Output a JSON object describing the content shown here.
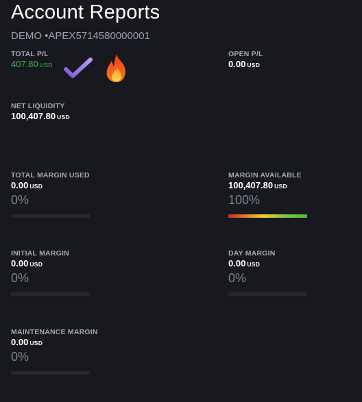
{
  "header": {
    "title": "Account Reports",
    "account_id": "DEMO •APEX5714580000001"
  },
  "metrics": {
    "total_pl": {
      "label": "TOTAL P/L",
      "value": "407.80",
      "unit": "USD"
    },
    "open_pl": {
      "label": "OPEN P/L",
      "value": "0.00",
      "unit": "USD"
    },
    "net_liquidity": {
      "label": "NET LIQUIDITY",
      "value": "100,407.80",
      "unit": "USD"
    },
    "total_margin_used": {
      "label": "TOTAL MARGIN USED",
      "value": "0.00",
      "unit": "USD",
      "percent": "0%",
      "fill_fraction": 0
    },
    "margin_available": {
      "label": "MARGIN AVAILABLE",
      "value": "100,407.80",
      "unit": "USD",
      "percent": "100%",
      "fill_fraction": 1
    },
    "initial_margin": {
      "label": "INITIAL MARGIN",
      "value": "0.00",
      "unit": "USD",
      "percent": "0%",
      "fill_fraction": 0
    },
    "day_margin": {
      "label": "DAY MARGIN",
      "value": "0.00",
      "unit": "USD",
      "percent": "0%",
      "fill_fraction": 0
    },
    "maintenance_margin": {
      "label": "MAINTENANCE MARGIN",
      "value": "0.00",
      "unit": "USD",
      "percent": "0%",
      "fill_fraction": 0
    }
  },
  "icons": {
    "checkmark": "checkmark-icon",
    "fire": "fire-icon"
  },
  "colors": {
    "background": "#17191e",
    "positive": "#3db34a",
    "label": "#a4a9b2",
    "muted_percent": "#7d828b",
    "bar_track": "#25272d"
  }
}
